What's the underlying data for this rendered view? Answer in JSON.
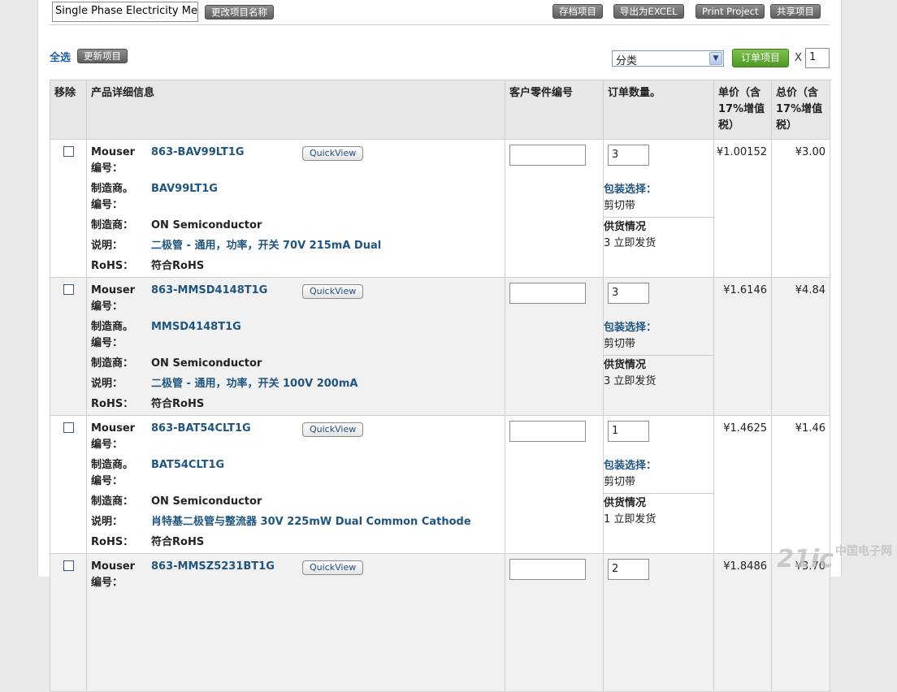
{
  "header": {
    "project_name_value": "Single Phase Electricity Met",
    "rename_button": "更改项目名称",
    "save_button": "存档项目",
    "export_button": "导出为EXCEL",
    "print_button": "Print Project",
    "share_button": "共享项目"
  },
  "toolbar": {
    "select_all": "全选",
    "update_button": "更新项目",
    "category_select": "分类",
    "order_button": "订单项目",
    "times_label": "X",
    "quantity_value": "1"
  },
  "table": {
    "headers": {
      "remove": "移除",
      "details": "产品详细信息",
      "customer_part": "客户零件编号",
      "order_qty": "订单数量。",
      "unit_price": "单价（含17%增值税）",
      "total_price": "总价（含17%增值税）"
    },
    "labels": {
      "mouser_no": "Mouser 编号：",
      "mfr_no": "制造商。 编号：",
      "mfr": "制造商：",
      "desc": "说明：",
      "rohs": "RoHS：",
      "quickview": "QuickView",
      "packaging": "包装选择：",
      "supply": "供货情况"
    },
    "rows": [
      {
        "mouser_no": "863-BAV99LT1G",
        "mfr_no": "BAV99LT1G",
        "mfr": "ON Semiconductor",
        "desc": "二极管 - 通用，功率，开关 70V 215mA Dual",
        "rohs": "符合RoHS",
        "qty": "3",
        "packaging": "剪切带",
        "supply": "3 立即发货",
        "unit_price": "¥1.00152",
        "total_price": "¥3.00"
      },
      {
        "mouser_no": "863-MMSD4148T1G",
        "mfr_no": "MMSD4148T1G",
        "mfr": "ON Semiconductor",
        "desc": "二极管 - 通用，功率，开关 100V 200mA",
        "rohs": "符合RoHS",
        "qty": "3",
        "packaging": "剪切带",
        "supply": "3 立即发货",
        "unit_price": "¥1.6146",
        "total_price": "¥4.84"
      },
      {
        "mouser_no": "863-BAT54CLT1G",
        "mfr_no": "BAT54CLT1G",
        "mfr": "ON Semiconductor",
        "desc": "肖特基二极管与整流器 30V 225mW Dual Common Cathode",
        "rohs": "符合RoHS",
        "qty": "1",
        "packaging": "剪切带",
        "supply": "1 立即发货",
        "unit_price": "¥1.4625",
        "total_price": "¥1.46"
      },
      {
        "mouser_no": "863-MMSZ5231BT1G",
        "mfr_no": "",
        "mfr": "",
        "desc": "",
        "rohs": "",
        "qty": "2",
        "packaging": "",
        "supply": "",
        "unit_price": "¥1.8486",
        "total_price": "¥3.70"
      }
    ]
  },
  "watermark": {
    "text": "21ic",
    "sub": "中国电子网"
  }
}
